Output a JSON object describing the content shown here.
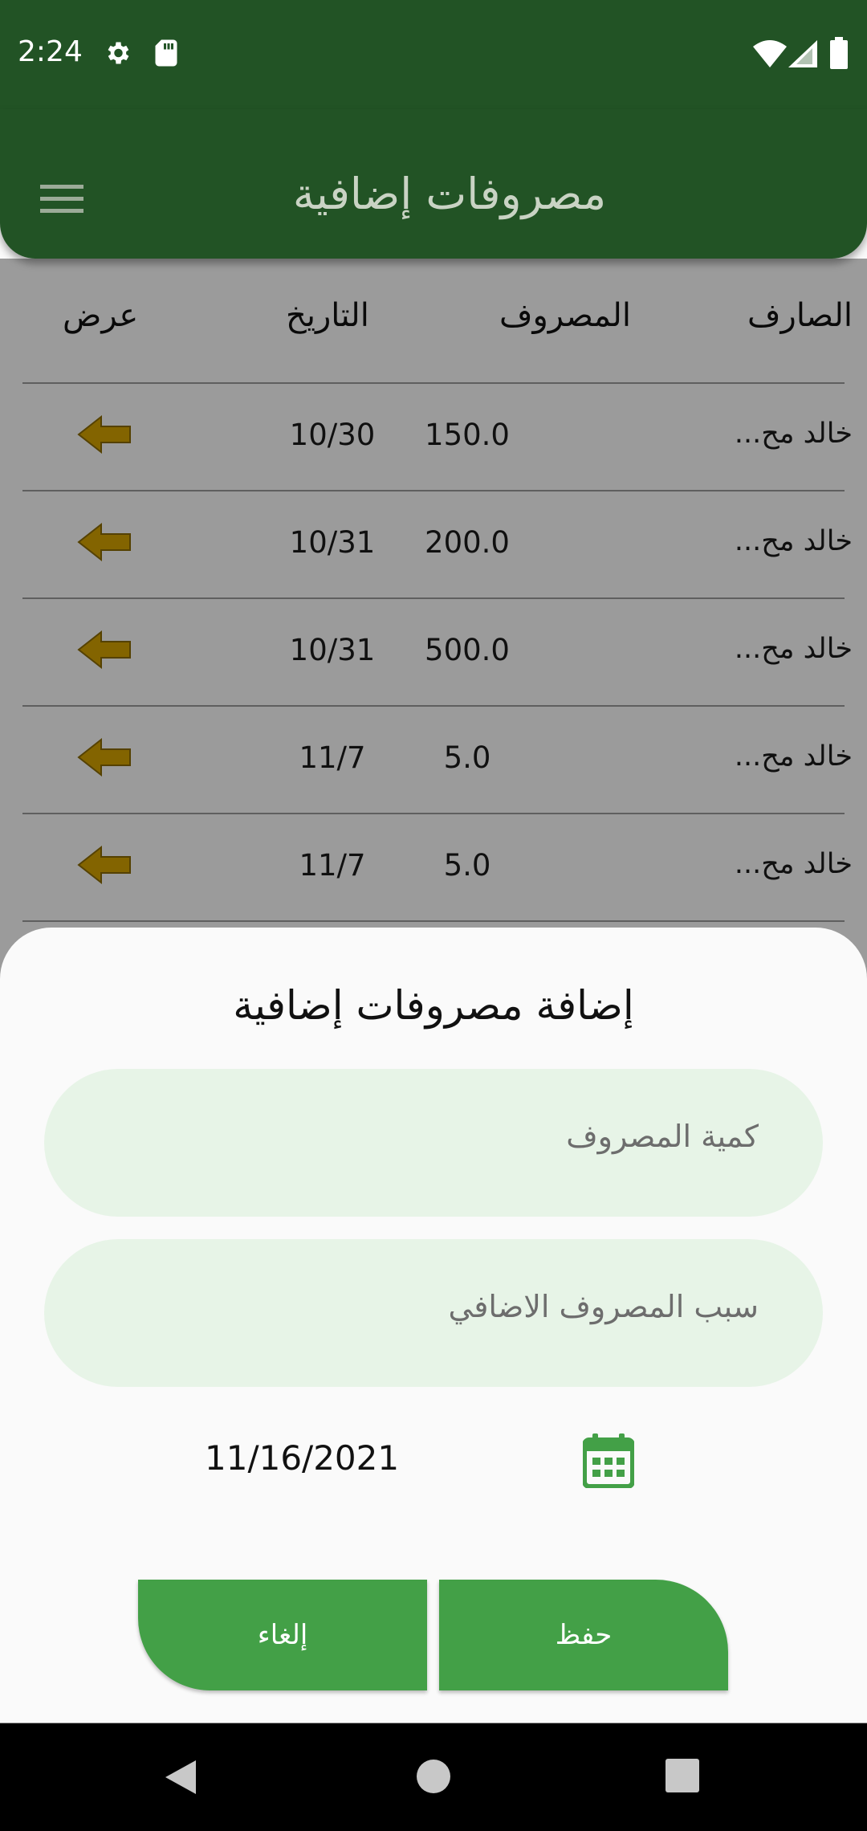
{
  "status_bar": {
    "time": "2:24",
    "icons": [
      "settings-icon",
      "sd-card-icon",
      "wifi-icon",
      "signal-icon",
      "battery-icon"
    ]
  },
  "app_bar": {
    "title": "مصروفات إضافية",
    "menu_icon": "menu-icon"
  },
  "table": {
    "headers": {
      "payer": "الصارف",
      "amount": "المصروف",
      "date": "التاريخ",
      "view": "عرض"
    },
    "rows": [
      {
        "payer": "خالد مح...",
        "amount": "150.0",
        "date": "10/30"
      },
      {
        "payer": "خالد مح...",
        "amount": "200.0",
        "date": "10/31"
      },
      {
        "payer": "خالد مح...",
        "amount": "500.0",
        "date": "10/31"
      },
      {
        "payer": "خالد مح...",
        "amount": "5.0",
        "date": "11/7"
      },
      {
        "payer": "خالد مح...",
        "amount": "5.0",
        "date": "11/7"
      }
    ],
    "view_icon": "arrow-left-icon"
  },
  "sheet": {
    "title": "إضافة مصروفات إضافية",
    "amount_placeholder": "كمية المصروف",
    "reason_placeholder": "سبب المصروف الاضافي",
    "date": "11/16/2021",
    "calendar_icon": "calendar-icon",
    "save_label": "حفظ",
    "cancel_label": "إلغاء"
  },
  "colors": {
    "primary_dark": "#225325",
    "button_green": "#43a047",
    "field_bg": "#e7f4e7",
    "arrow": "#d4a200"
  }
}
